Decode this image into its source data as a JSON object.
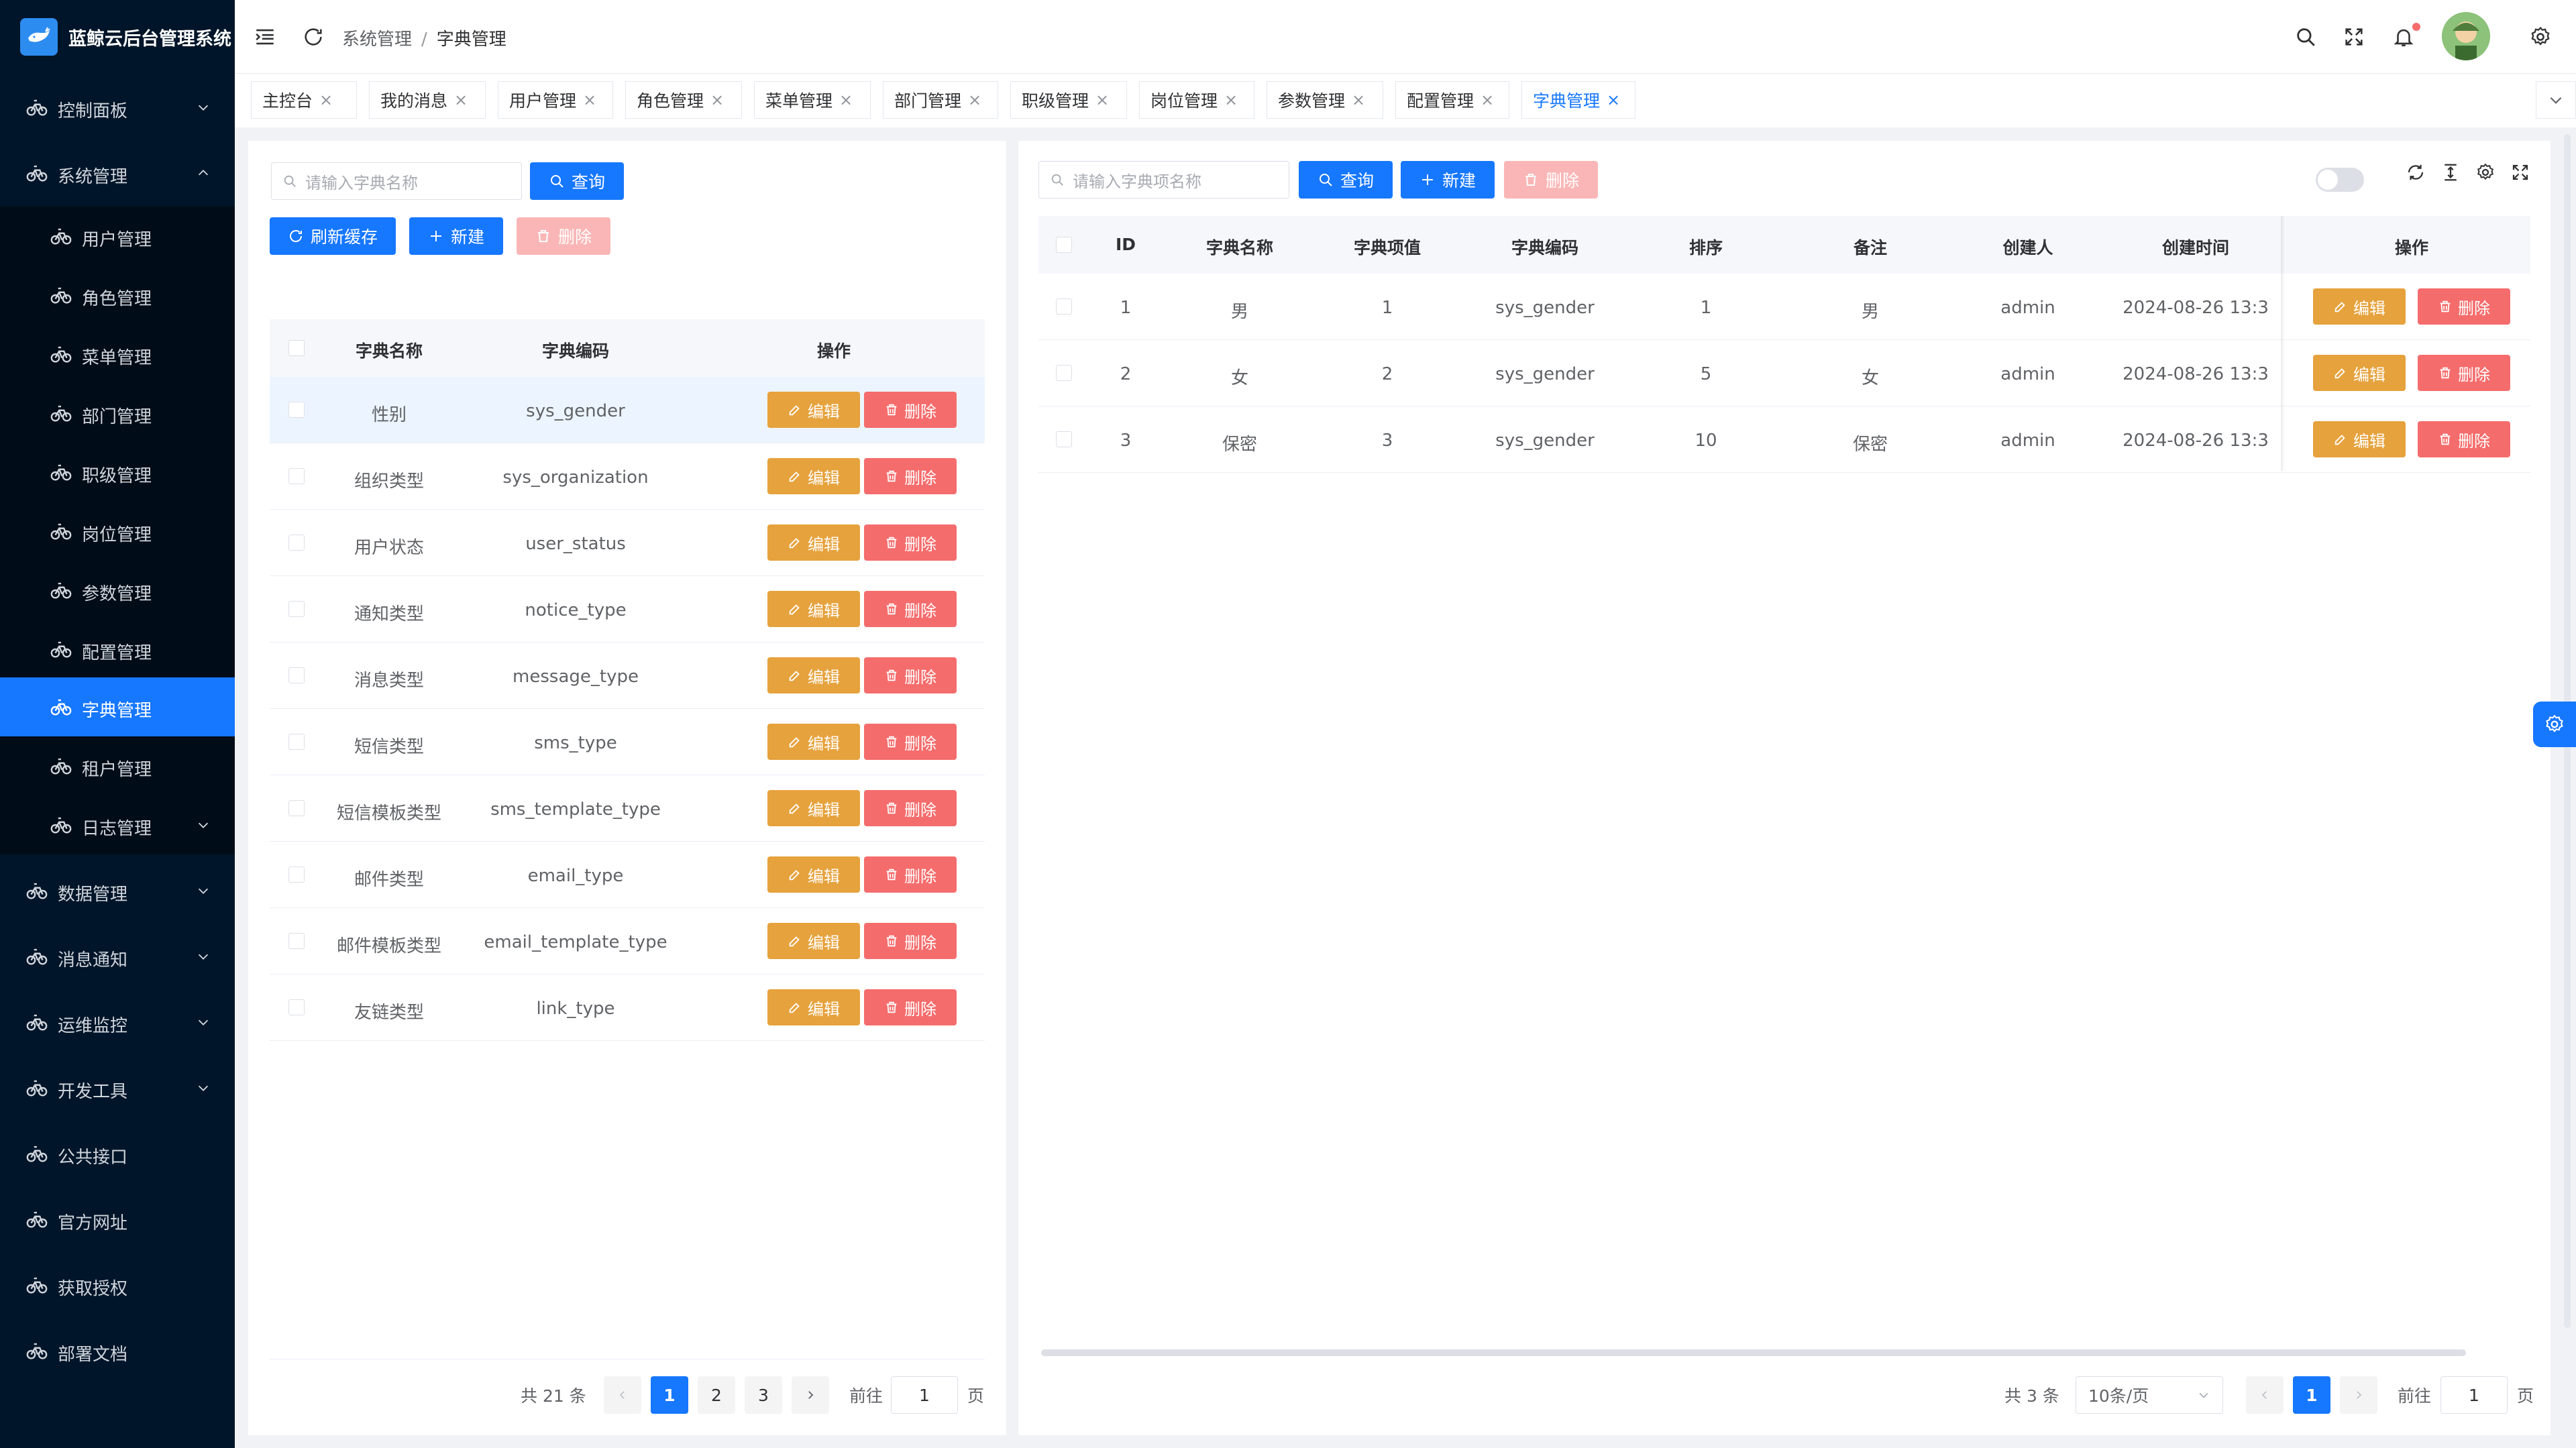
{
  "app": {
    "title": "蓝鲸云后台管理系统"
  },
  "sidebar": {
    "items": [
      {
        "label": "控制面板",
        "arrow": "down"
      },
      {
        "label": "系统管理",
        "arrow": "up"
      },
      {
        "label": "用户管理",
        "child": true
      },
      {
        "label": "角色管理",
        "child": true
      },
      {
        "label": "菜单管理",
        "child": true
      },
      {
        "label": "部门管理",
        "child": true
      },
      {
        "label": "职级管理",
        "child": true
      },
      {
        "label": "岗位管理",
        "child": true
      },
      {
        "label": "参数管理",
        "child": true
      },
      {
        "label": "配置管理",
        "child": true
      },
      {
        "label": "字典管理",
        "child": true,
        "active": true
      },
      {
        "label": "租户管理",
        "child": true
      },
      {
        "label": "日志管理",
        "child": true,
        "arrow": "down"
      },
      {
        "label": "数据管理",
        "arrow": "down"
      },
      {
        "label": "消息通知",
        "arrow": "down"
      },
      {
        "label": "运维监控",
        "arrow": "down"
      },
      {
        "label": "开发工具",
        "arrow": "down"
      },
      {
        "label": "公共接口"
      },
      {
        "label": "官方网址"
      },
      {
        "label": "获取授权"
      },
      {
        "label": "部署文档"
      }
    ]
  },
  "header": {
    "breadcrumb": [
      "系统管理",
      "字典管理"
    ],
    "separator": "/"
  },
  "tabs": [
    {
      "label": "主控台"
    },
    {
      "label": "我的消息"
    },
    {
      "label": "用户管理"
    },
    {
      "label": "角色管理"
    },
    {
      "label": "菜单管理"
    },
    {
      "label": "部门管理"
    },
    {
      "label": "职级管理"
    },
    {
      "label": "岗位管理"
    },
    {
      "label": "参数管理"
    },
    {
      "label": "配置管理"
    },
    {
      "label": "字典管理",
      "active": true
    }
  ],
  "left_panel": {
    "search_placeholder": "请输入字典名称",
    "query_label": "查询",
    "refresh_label": "刷新缓存",
    "new_label": "新建",
    "delete_label": "删除",
    "columns": [
      "字典名称",
      "字典编码",
      "操作"
    ],
    "rows": [
      {
        "name": "性别",
        "code": "sys_gender"
      },
      {
        "name": "组织类型",
        "code": "sys_organization"
      },
      {
        "name": "用户状态",
        "code": "user_status"
      },
      {
        "name": "通知类型",
        "code": "notice_type"
      },
      {
        "name": "消息类型",
        "code": "message_type"
      },
      {
        "name": "短信类型",
        "code": "sms_type"
      },
      {
        "name": "短信模板类型",
        "code": "sms_template_type"
      },
      {
        "name": "邮件类型",
        "code": "email_type"
      },
      {
        "name": "邮件模板类型",
        "code": "email_template_type"
      },
      {
        "name": "友链类型",
        "code": "link_type"
      }
    ],
    "edit_label": "编辑",
    "row_delete_label": "删除",
    "pagination": {
      "total": "共 21 条",
      "pages": [
        "1",
        "2",
        "3"
      ],
      "current": "1",
      "goto": "前往",
      "goto_value": "1",
      "page_unit": "页"
    }
  },
  "right_panel": {
    "search_placeholder": "请输入字典项名称",
    "query_label": "查询",
    "new_label": "新建",
    "delete_label": "删除",
    "columns": [
      "ID",
      "字典名称",
      "字典项值",
      "字典编码",
      "排序",
      "备注",
      "创建人",
      "创建时间",
      "操作"
    ],
    "rows": [
      {
        "id": "1",
        "name": "男",
        "value": "1",
        "code": "sys_gender",
        "sort": "1",
        "remark": "男",
        "creator": "admin",
        "created": "2024-08-26 13:3"
      },
      {
        "id": "2",
        "name": "女",
        "value": "2",
        "code": "sys_gender",
        "sort": "5",
        "remark": "女",
        "creator": "admin",
        "created": "2024-08-26 13:3"
      },
      {
        "id": "3",
        "name": "保密",
        "value": "3",
        "code": "sys_gender",
        "sort": "10",
        "remark": "保密",
        "creator": "admin",
        "created": "2024-08-26 13:3"
      }
    ],
    "edit_label": "编辑",
    "row_delete_label": "删除",
    "pagination": {
      "total": "共 3 条",
      "page_size": "10条/页",
      "current": "1",
      "goto": "前往",
      "goto_value": "1",
      "page_unit": "页"
    }
  },
  "colors": {
    "primary": "#1677ff",
    "sidebar": "#001529",
    "warning": "#e6a23c",
    "danger": "#f56c6c"
  }
}
